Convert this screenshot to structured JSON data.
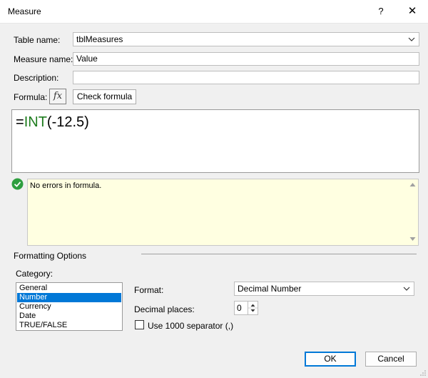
{
  "window": {
    "title": "Measure",
    "help_label": "?",
    "close_label": "✕"
  },
  "fields": {
    "table_name_label": "Table name:",
    "table_name_value": "tblMeasures",
    "measure_name_label": "Measure name:",
    "measure_name_value": "Value",
    "description_label": "Description:",
    "description_value": "",
    "formula_label": "Formula:",
    "fx_label": "fx",
    "check_formula_label": "Check formula"
  },
  "formula": {
    "prefix": "=",
    "function": "INT",
    "args": "(-12.5)"
  },
  "message": {
    "text": "No errors in formula."
  },
  "formatting": {
    "section_label": "Formatting Options",
    "category_label": "Category:",
    "categories": [
      "General",
      "Number",
      "Currency",
      "Date",
      "TRUE/FALSE"
    ],
    "selected_category": "Number",
    "format_label": "Format:",
    "format_value": "Decimal Number",
    "decimal_places_label": "Decimal places:",
    "decimal_places_value": "0",
    "separator_label": "Use 1000 separator (,)",
    "separator_checked": false
  },
  "buttons": {
    "ok_label": "OK",
    "cancel_label": "Cancel"
  },
  "colors": {
    "accent": "#0078d7",
    "function": "#1e7c1e",
    "message_bg": "#ffffe1",
    "success": "#2e9e3f"
  }
}
